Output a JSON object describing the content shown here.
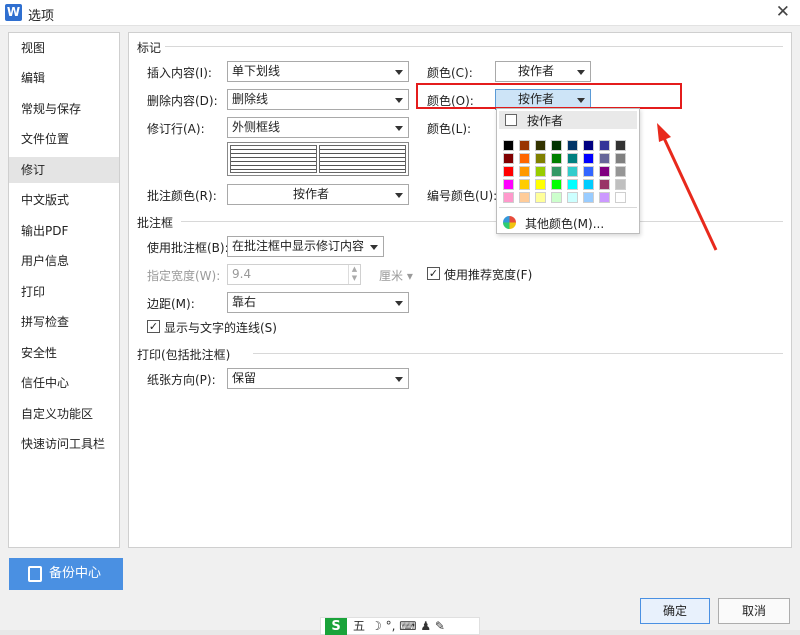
{
  "window": {
    "title": "选项",
    "app_icon_text": "W",
    "close_glyph": "✕"
  },
  "sidebar": {
    "items": [
      {
        "label": "视图"
      },
      {
        "label": "编辑"
      },
      {
        "label": "常规与保存"
      },
      {
        "label": "文件位置"
      },
      {
        "label": "修订",
        "active": true
      },
      {
        "label": "中文版式"
      },
      {
        "label": "输出PDF"
      },
      {
        "label": "用户信息"
      },
      {
        "label": "打印"
      },
      {
        "label": "拼写检查"
      },
      {
        "label": "安全性"
      },
      {
        "label": "信任中心"
      },
      {
        "label": "自定义功能区"
      },
      {
        "label": "快速访问工具栏"
      }
    ],
    "backup_label": "备份中心"
  },
  "markup": {
    "section_title": "标记",
    "insert_label": "插入内容(I):",
    "insert_value": "单下划线",
    "delete_label": "删除内容(D):",
    "delete_value": "删除线",
    "revline_label": "修订行(A):",
    "revline_value": "外侧框线",
    "comment_color_label": "批注颜色(R):",
    "comment_color_value": "按作者",
    "color_c_label": "颜色(C):",
    "color_c_value": "按作者",
    "color_o_label": "颜色(O):",
    "color_o_value": "按作者",
    "color_l_label": "颜色(L):",
    "number_color_label": "编号颜色(U):"
  },
  "color_dropdown": {
    "auto_label": "按作者",
    "more_label": "其他颜色(M)...",
    "swatches": [
      [
        "#000000",
        "#993300",
        "#333300",
        "#003300",
        "#003366",
        "#000080",
        "#333399",
        "#333333"
      ],
      [
        "#800000",
        "#ff6600",
        "#808000",
        "#008000",
        "#008080",
        "#0000ff",
        "#666699",
        "#808080"
      ],
      [
        "#ff0000",
        "#ff9900",
        "#99cc00",
        "#339966",
        "#33cccc",
        "#3366ff",
        "#800080",
        "#969696"
      ],
      [
        "#ff00ff",
        "#ffcc00",
        "#ffff00",
        "#00ff00",
        "#00ffff",
        "#00ccff",
        "#993366",
        "#c0c0c0"
      ],
      [
        "#ff99cc",
        "#ffcc99",
        "#ffff99",
        "#ccffcc",
        "#ccffff",
        "#99ccff",
        "#cc99ff",
        "#ffffff"
      ]
    ]
  },
  "balloons": {
    "section_title": "批注框",
    "use_label": "使用批注框(B):",
    "use_value": "在批注框中显示修订内容",
    "width_label": "指定宽度(W):",
    "width_value": "9.4",
    "unit_value": "厘米",
    "recommend_label": "使用推荐宽度(F)",
    "recommend_checked": true,
    "margin_label": "边距(M):",
    "margin_value": "靠右",
    "lines_label": "显示与文字的连线(S)",
    "lines_checked": true
  },
  "print": {
    "section_title": "打印(包括批注框)",
    "orientation_label": "纸张方向(P):",
    "orientation_value": "保留"
  },
  "footer": {
    "ok_label": "确定",
    "cancel_label": "取消"
  },
  "taskbar": {
    "s_label": "S",
    "five_label": "五",
    "icons_text": "☽ °, ⌨ ♟ ✎"
  },
  "colors": {
    "highlight_border": "#e41c1c",
    "arrow": "#e8291c",
    "backup_bg": "#4a90e2",
    "selected_bg": "#cde4f7"
  }
}
